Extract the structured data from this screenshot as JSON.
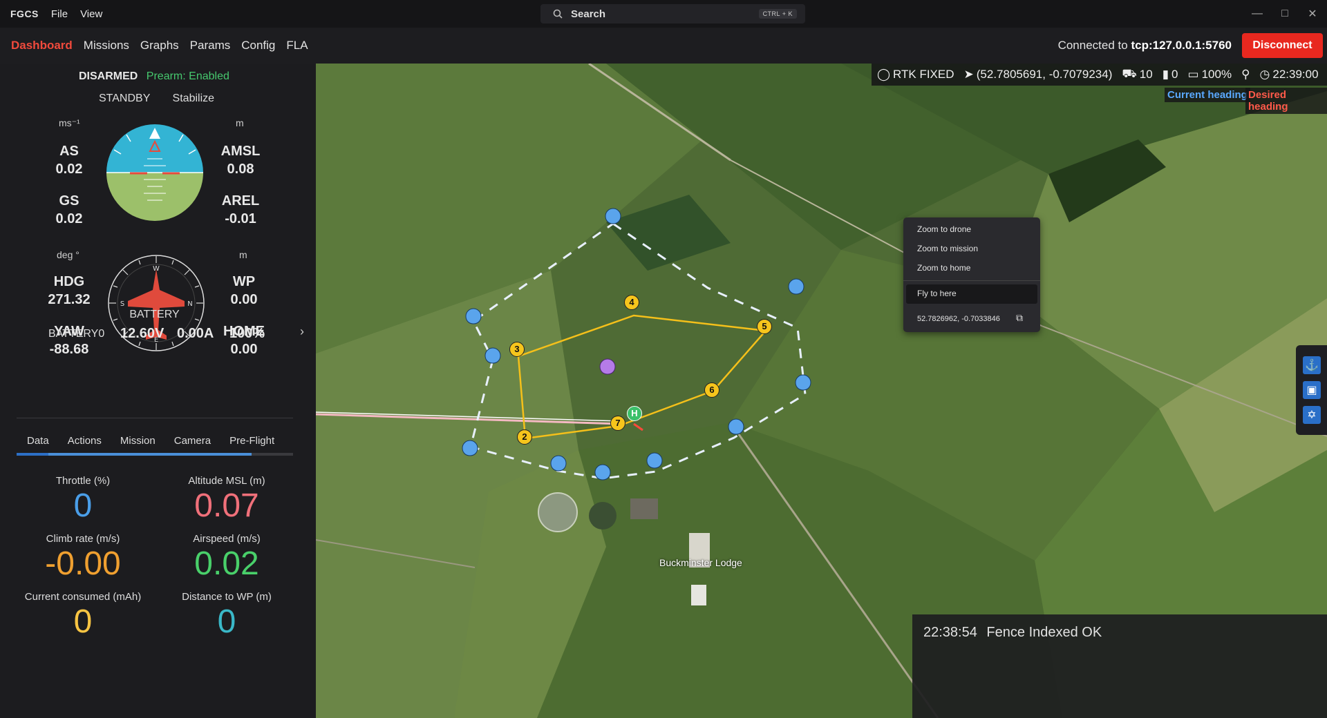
{
  "titlebar": {
    "brand": "FGCS",
    "menus": [
      "File",
      "View"
    ]
  },
  "search": {
    "label": "Search",
    "shortcut": "CTRL + K"
  },
  "nav": {
    "items": [
      "Dashboard",
      "Missions",
      "Graphs",
      "Params",
      "Config",
      "FLA"
    ],
    "active": "Dashboard"
  },
  "connection": {
    "prefix": "Connected to",
    "target": "tcp:127.0.0.1:5760",
    "disconnect_label": "Disconnect"
  },
  "status": {
    "arm": "DISARMED",
    "prearm": "Prearm: Enabled",
    "system_status": "STANDBY",
    "mode": "Stabilize"
  },
  "units": {
    "speed": "ms⁻¹",
    "alt": "m",
    "angle": "deg °",
    "dist": "m"
  },
  "telemetry": {
    "as_label": "AS",
    "as_value": "0.02",
    "gs_label": "GS",
    "gs_value": "0.02",
    "amsl_label": "AMSL",
    "amsl_value": "0.08",
    "arel_label": "AREL",
    "arel_value": "-0.01",
    "hdg_label": "HDG",
    "hdg_value": "271.32",
    "yaw_label": "YAW",
    "yaw_value": "-88.68",
    "wp_label": "WP",
    "wp_value": "0.00",
    "home_label": "HOME",
    "home_value": "0.00"
  },
  "battery": {
    "title": "BATTERY",
    "name": "BATTERY0",
    "voltage": "12.60V",
    "current": "0.00A",
    "percent": "100%"
  },
  "tabs": [
    "Data",
    "Actions",
    "Mission",
    "Camera",
    "Pre-Flight C"
  ],
  "metrics": [
    {
      "label": "Throttle (%)",
      "value": "0",
      "color": "#4a9ee8"
    },
    {
      "label": "Altitude MSL (m)",
      "value": "0.07",
      "color": "#f0707a"
    },
    {
      "label": "Climb rate (m/s)",
      "value": "-0.00",
      "color": "#f0a030"
    },
    {
      "label": "Airspeed (m/s)",
      "value": "0.02",
      "color": "#49d06a"
    },
    {
      "label": "Current consumed (mAh)",
      "value": "0",
      "color": "#f7c443"
    },
    {
      "label": "Distance to WP (m)",
      "value": "0",
      "color": "#3ab8c8"
    }
  ],
  "map_status": {
    "rtk": "RTK FIXED",
    "position": "(52.7805691, -0.7079234)",
    "sats": "10",
    "signal": "0",
    "battery": "100%",
    "time": "22:39:00"
  },
  "heading_legend": {
    "current": "Current heading",
    "desired": "Desired heading",
    "current_color": "#5aa9ff",
    "desired_color": "#ff5a4a"
  },
  "context_menu": {
    "zoom_drone": "Zoom to drone",
    "zoom_mission": "Zoom to mission",
    "zoom_home": "Zoom to home",
    "fly_here": "Fly to here",
    "coords": "52.7826962, -0.7033846"
  },
  "map_label": "Buckminster Lodge",
  "waypoints": [
    "2",
    "3",
    "4",
    "5",
    "6",
    "7"
  ],
  "home_marker": "H",
  "log": {
    "time": "22:38:54",
    "message": "Fence Indexed OK"
  }
}
